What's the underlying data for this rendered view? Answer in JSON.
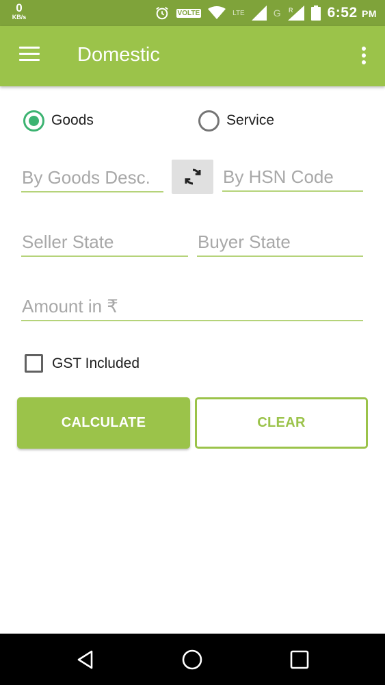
{
  "status_bar": {
    "speed_value": "0",
    "speed_unit": "KB/s",
    "volte": "VOLTE",
    "lte": "LTE",
    "network_g": "G",
    "roaming": "R",
    "time": "6:52",
    "ampm": "PM",
    "icons": [
      "alarm-icon",
      "wifi-icon",
      "signal-icon",
      "battery-icon"
    ]
  },
  "app_bar": {
    "title": "Domestic",
    "menu_icon": "hamburger-menu-icon",
    "overflow_icon": "more-vert-icon"
  },
  "type_selector": {
    "options": [
      {
        "label": "Goods",
        "checked": true
      },
      {
        "label": "Service",
        "checked": false
      }
    ]
  },
  "form": {
    "goods_desc_placeholder": "By Goods Desc.",
    "hsn_code_placeholder": "By HSN Code",
    "seller_state_placeholder": "Seller State",
    "buyer_state_placeholder": "Buyer State",
    "amount_placeholder": "Amount in ₹",
    "gst_included_label": "GST Included",
    "gst_included_checked": false
  },
  "actions": {
    "calculate_label": "CALCULATE",
    "clear_label": "CLEAR"
  },
  "colors": {
    "primary": "#9bc34a",
    "status_bar": "#7fa33a",
    "radio_accent": "#3cb371",
    "underline": "#b5d37a"
  }
}
